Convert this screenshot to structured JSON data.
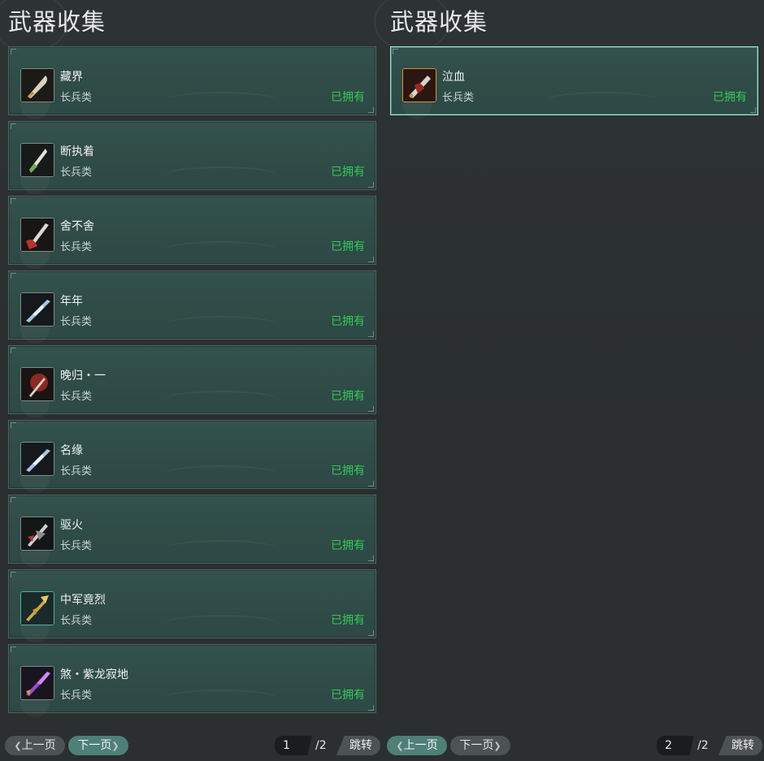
{
  "left_panel": {
    "title": "武器收集",
    "items": [
      {
        "name": "藏界",
        "type": "长兵类",
        "status": "已拥有",
        "icon": "blade-icon"
      },
      {
        "name": "断执着",
        "type": "长兵类",
        "status": "已拥有",
        "icon": "spear-icon"
      },
      {
        "name": "舍不舍",
        "type": "长兵类",
        "status": "已拥有",
        "icon": "spear-icon"
      },
      {
        "name": "年年",
        "type": "长兵类",
        "status": "已拥有",
        "icon": "crystal-spear-icon"
      },
      {
        "name": "晚归・一",
        "type": "长兵类",
        "status": "已拥有",
        "icon": "axe-icon"
      },
      {
        "name": "名缘",
        "type": "长兵类",
        "status": "已拥有",
        "icon": "crystal-spear-icon"
      },
      {
        "name": "驱火",
        "type": "长兵类",
        "status": "已拥有",
        "icon": "halberd-icon"
      },
      {
        "name": "中军竟烈",
        "type": "长兵类",
        "status": "已拥有",
        "icon": "trident-icon"
      },
      {
        "name": "煞・紫龙寂地",
        "type": "长兵类",
        "status": "已拥有",
        "icon": "dragon-spear-icon"
      }
    ],
    "pager": {
      "prev_label": "上一页",
      "next_label": "下一页",
      "current_page": "1",
      "total_label": "/2",
      "jump_label": "跳转"
    }
  },
  "right_panel": {
    "title": "武器收集",
    "items": [
      {
        "name": "泣血",
        "type": "长兵类",
        "status": "已拥有",
        "icon": "glaive-icon",
        "selected": true
      }
    ],
    "pager": {
      "prev_label": "上一页",
      "next_label": "下一页",
      "current_page": "2",
      "total_label": "/2",
      "jump_label": "跳转"
    }
  },
  "colors": {
    "owned_status": "#35c95a",
    "card_bg": "#2f4c47",
    "selected_border": "#9be6d6",
    "enabled_button": "#4e8077",
    "disabled_button": "#4d5253"
  }
}
